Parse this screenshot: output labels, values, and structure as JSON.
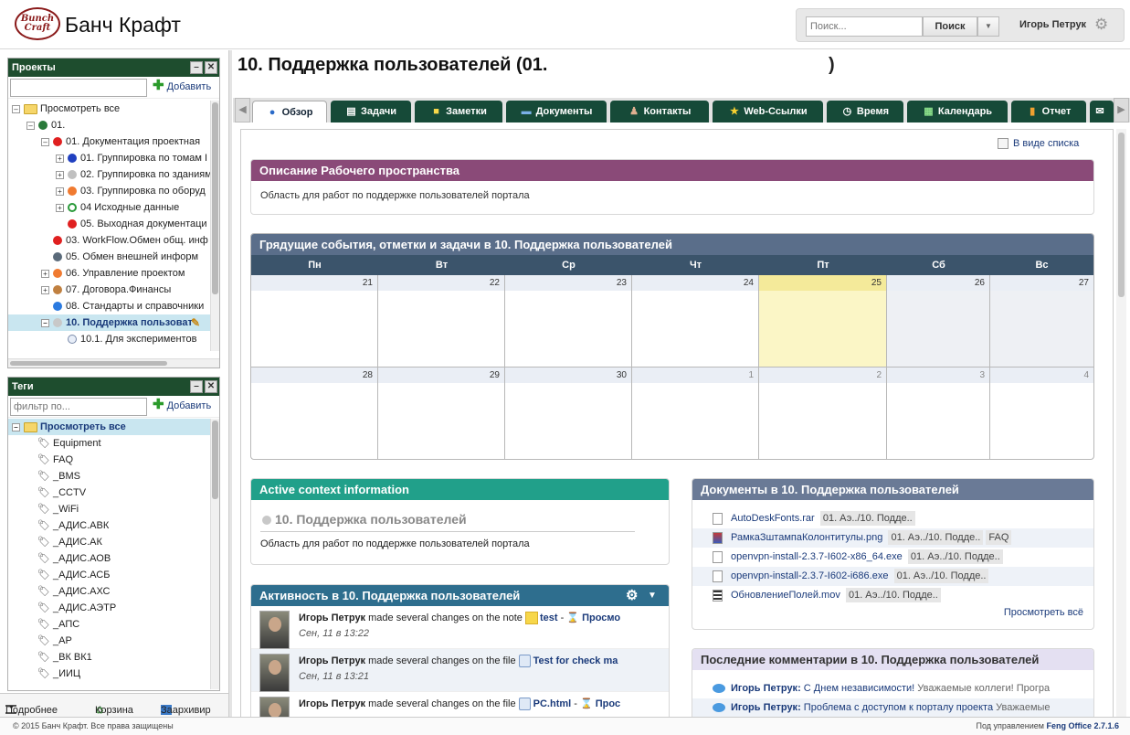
{
  "header": {
    "logo_line1": "Bunch",
    "logo_line2": "Craft",
    "app_title": "Банч Крафт",
    "search_placeholder": "Поиск...",
    "search_button": "Поиск",
    "user_name": "Игорь Петрук"
  },
  "projects_panel": {
    "title": "Проекты",
    "add_label": "Добавить",
    "items": [
      {
        "label": "Просмотреть все",
        "color": "folder"
      },
      {
        "label": "01.",
        "color": "#2a7a3a"
      },
      {
        "label": "01. Документация проектная",
        "color": "#e02020"
      },
      {
        "label": "01. Группировка по томам I",
        "color": "#2040c0"
      },
      {
        "label": "02. Группировка по зданиям",
        "color": "#c0c0c0"
      },
      {
        "label": "03. Группировка по оборуд",
        "color": "#f07a30"
      },
      {
        "label": "04 Исходные данные",
        "color": "#2a9a3a"
      },
      {
        "label": "05. Выходная документаци",
        "color": "#e02020"
      },
      {
        "label": "03. WorkFlow.Обмен общ. инф",
        "color": "#e02020"
      },
      {
        "label": "05. Обмен внешней информ",
        "color": "#5a6a7a"
      },
      {
        "label": "06. Управление проектом",
        "color": "#f07a30"
      },
      {
        "label": "07. Договора.Финансы",
        "color": "#c08040"
      },
      {
        "label": "08. Стандарты и справочники",
        "color": "#2a7ae0"
      },
      {
        "label": "10. Поддержка пользоват",
        "color": "#c8c8c8"
      },
      {
        "label": "10.1. Для экспериментов",
        "color": "#e8eef8"
      }
    ]
  },
  "tags_panel": {
    "title": "Теги",
    "filter_placeholder": "фильтр по...",
    "add_label": "Добавить",
    "items": [
      "Просмотреть все",
      "Equipment",
      "FAQ",
      "_BMS",
      "_CCTV",
      "_WiFi",
      "_АДИС.АВК",
      "_АДИС.АК",
      "_АДИС.АОВ",
      "_АДИС.АСБ",
      "_АДИС.АХС",
      "_АДИС.АЭТР",
      "_АПС",
      "_АР",
      "_ВК ВК1",
      "_ИИЦ"
    ]
  },
  "bottom_bar": {
    "more": "Подробнее",
    "trash": "Корзина",
    "archive": "Заархивир"
  },
  "footer": {
    "copyright": "© 2015 Банч Крафт. Все права защищены",
    "powered_prefix": "Под управлением",
    "powered_name": "Feng Office 2.7.1.6"
  },
  "main": {
    "title": "10. Поддержка пользователей (01.",
    "title_end": ")",
    "view_list": "В виде списка",
    "tabs": [
      "Обзор",
      "Задачи",
      "Заметки",
      "Документы",
      "Контакты",
      "Web-Ссылки",
      "Время",
      "Календарь",
      "Отчет"
    ]
  },
  "workspace_desc": {
    "title": "Описание Рабочего пространства",
    "text": "Область для работ по поддержке пользователей портала",
    "color": "#8a4a78"
  },
  "calendar": {
    "title": "Грядущие события, отметки и задачи в 10. Поддержка пользователей",
    "days": [
      "Пн",
      "Вт",
      "Ср",
      "Чт",
      "Пт",
      "Сб",
      "Вс"
    ],
    "weeks": [
      [
        "21",
        "22",
        "23",
        "24",
        "25",
        "26",
        "27"
      ],
      [
        "28",
        "29",
        "30",
        "1",
        "2",
        "3",
        "4"
      ]
    ],
    "color": "#5a6e8a"
  },
  "context": {
    "title": "Active context information",
    "ws_name": "10. Поддержка пользователей",
    "text": "Область для работ по поддержке пользователей портала",
    "color": "#21a08a"
  },
  "activity": {
    "title": "Активность в 10. Поддержка пользователей",
    "color": "#2e6e8e",
    "items": [
      {
        "user": "Игорь Петрук",
        "action": "made several changes on the note",
        "object": "test",
        "extra": "Просмо",
        "time": "Сен, 11 в 13:22"
      },
      {
        "user": "Игорь Петрук",
        "action": "made several changes on the file",
        "object": "Test for check ma",
        "extra": "",
        "time": "Сен, 11 в 13:21"
      },
      {
        "user": "Игорь Петрук",
        "action": "made several changes on the file",
        "object": "PC.html",
        "extra": "Прос",
        "time": ""
      }
    ]
  },
  "documents": {
    "title": "Документы в 10. Поддержка пользователей",
    "color": "#6a7a96",
    "view_all": "Просмотреть всё",
    "items": [
      {
        "name": "AutoDeskFonts.rar",
        "loc": "01. Аэ../10. Подде..",
        "tag": ""
      },
      {
        "name": "РамкаЗштампаКолонтитулы.png",
        "loc": "01. Аэ../10. Подде..",
        "tag": "FAQ"
      },
      {
        "name": "openvpn-install-2.3.7-I602-x86_64.exe",
        "loc": "01. Аэ../10. Подде..",
        "tag": ""
      },
      {
        "name": "openvpn-install-2.3.7-I602-i686.exe",
        "loc": "01. Аэ../10. Подде..",
        "tag": ""
      },
      {
        "name": "ОбновлениеПолей.mov",
        "loc": "01. Аэ../10. Подде..",
        "tag": ""
      }
    ]
  },
  "comments": {
    "title": "Последние комментарии в 10. Поддержка пользователей",
    "color": "#e4e0f2",
    "items": [
      {
        "user": "Игорь Петрук:",
        "subject": "С Днем независимости!",
        "body": "Уважаемые коллеги! Програ"
      },
      {
        "user": "Игорь Петрук:",
        "subject": "Проблема с доступом к порталу проекта",
        "body": "Уважаемые"
      }
    ]
  }
}
